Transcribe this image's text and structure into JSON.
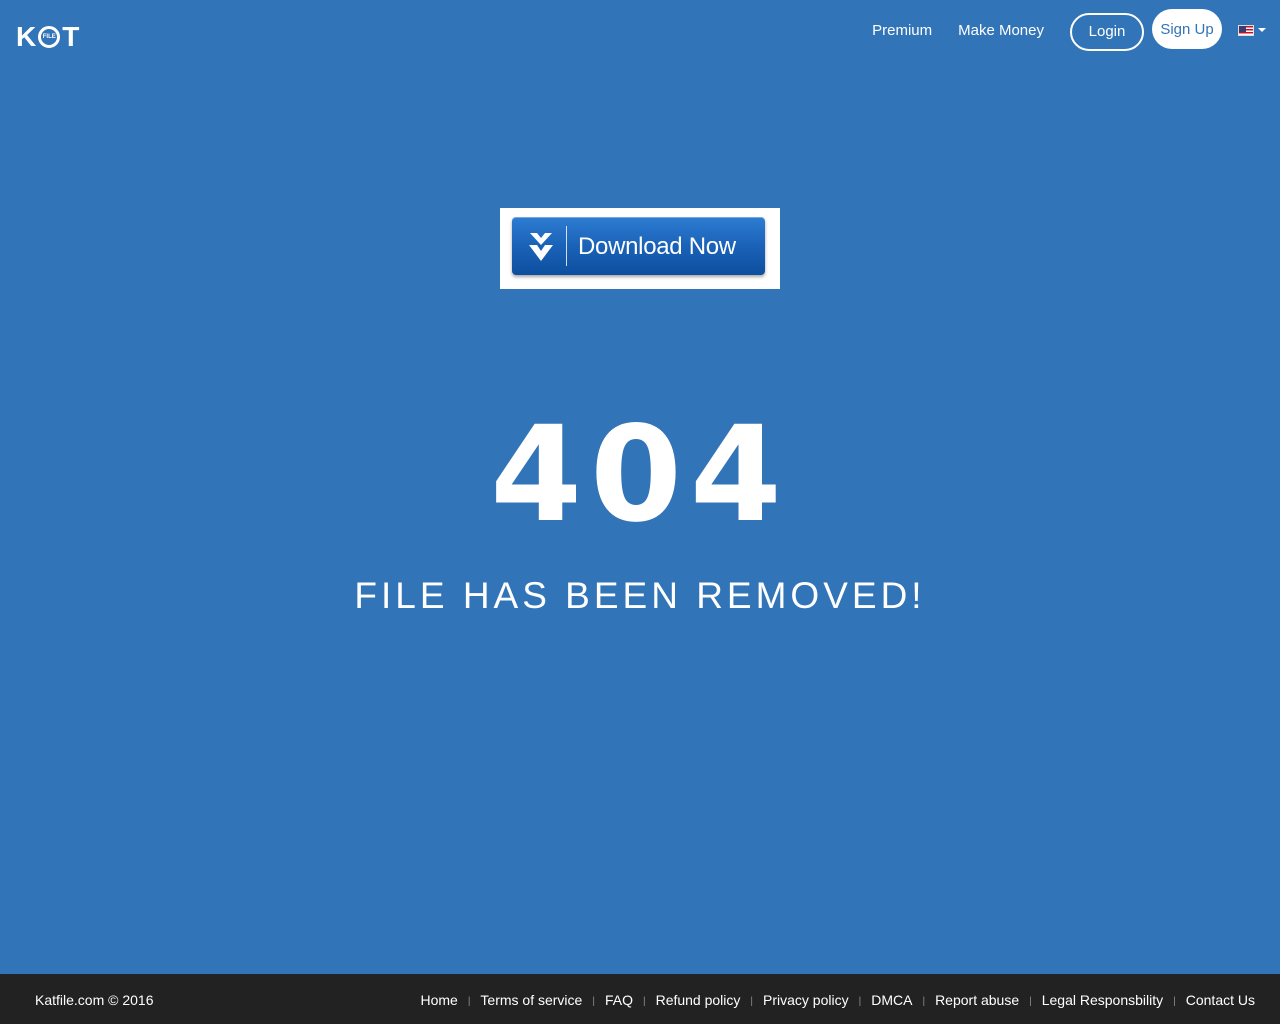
{
  "header": {
    "logo": {
      "left": "K",
      "circle": "FILE",
      "right": "T"
    },
    "nav": {
      "premium": "Premium",
      "make_money": "Make Money",
      "login": "Login",
      "signup": "Sign Up"
    },
    "language_icon": "us-flag-icon"
  },
  "download": {
    "label": "Download Now",
    "icon": "double-chevron-down-icon"
  },
  "error": {
    "code": "404",
    "message": "FILE HAS BEEN REMOVED!"
  },
  "footer": {
    "copyright": "Katfile.com © 2016",
    "separator": "|",
    "links": [
      "Home",
      "Terms of service",
      "FAQ",
      "Refund policy",
      "Privacy policy",
      "DMCA",
      "Report abuse",
      "Legal Responsbility",
      "Contact Us"
    ]
  },
  "colors": {
    "background": "#3274b8",
    "footer_background": "#222222",
    "button_blue": "#1a62b8"
  }
}
